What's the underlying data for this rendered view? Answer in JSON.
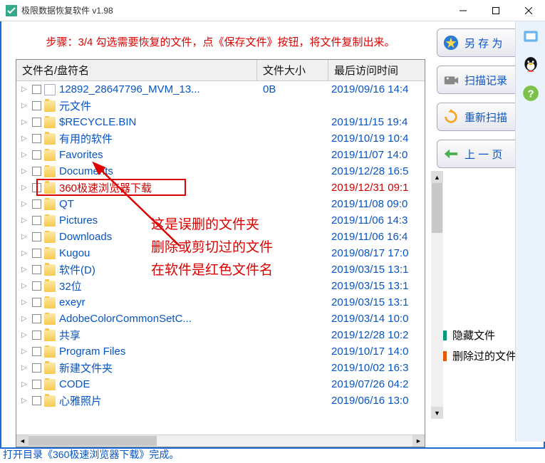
{
  "window": {
    "title": "极限数据恢复软件 v1.98"
  },
  "instruction": "步骤：3/4 勾选需要恢复的文件，点《保存文件》按钮，将文件复制出来。",
  "columns": {
    "name": "文件名/盘符名",
    "size": "文件大小",
    "date": "最后访问时间"
  },
  "files": [
    {
      "name": "12892_28647796_MVM_13...",
      "size": "0B",
      "date": "2019/09/16 14:4",
      "type": "file",
      "deleted": false
    },
    {
      "name": "元文件",
      "size": "",
      "date": "",
      "type": "folder",
      "deleted": false
    },
    {
      "name": "$RECYCLE.BIN",
      "size": "",
      "date": "2019/11/15 19:4",
      "type": "folder",
      "deleted": false
    },
    {
      "name": "有用的软件",
      "size": "",
      "date": "2019/10/19 10:4",
      "type": "folder",
      "deleted": false
    },
    {
      "name": "Favorites",
      "size": "",
      "date": "2019/11/07 14:0",
      "type": "folder",
      "deleted": false
    },
    {
      "name": "Documents",
      "size": "",
      "date": "2019/12/28 16:5",
      "type": "folder",
      "deleted": false
    },
    {
      "name": "360极速浏览器下载",
      "size": "",
      "date": "2019/12/31 09:1",
      "type": "folder",
      "deleted": true,
      "highlight": true
    },
    {
      "name": "QT",
      "size": "",
      "date": "2019/11/08 09:0",
      "type": "folder",
      "deleted": false
    },
    {
      "name": "Pictures",
      "size": "",
      "date": "2019/11/06 14:3",
      "type": "folder",
      "deleted": false
    },
    {
      "name": "Downloads",
      "size": "",
      "date": "2019/11/06 16:4",
      "type": "folder",
      "deleted": false
    },
    {
      "name": "Kugou",
      "size": "",
      "date": "2019/08/17 17:0",
      "type": "folder",
      "deleted": false
    },
    {
      "name": "软件(D)",
      "size": "",
      "date": "2019/03/15 13:1",
      "type": "folder",
      "deleted": false
    },
    {
      "name": "32位",
      "size": "",
      "date": "2019/03/15 13:1",
      "type": "folder",
      "deleted": false
    },
    {
      "name": "exeyr",
      "size": "",
      "date": "2019/03/15 13:1",
      "type": "folder",
      "deleted": false
    },
    {
      "name": "AdobeColorCommonSetC...",
      "size": "",
      "date": "2019/03/14 10:0",
      "type": "folder",
      "deleted": false
    },
    {
      "name": "共享",
      "size": "",
      "date": "2019/12/28 10:2",
      "type": "folder",
      "deleted": false
    },
    {
      "name": "Program Files",
      "size": "",
      "date": "2019/10/17 14:0",
      "type": "folder",
      "deleted": false
    },
    {
      "name": "新建文件夹",
      "size": "",
      "date": "2019/10/02 16:3",
      "type": "folder",
      "deleted": false
    },
    {
      "name": "CODE",
      "size": "",
      "date": "2019/07/26 04:2",
      "type": "folder",
      "deleted": false
    },
    {
      "name": "心雅照片",
      "size": "",
      "date": "2019/06/16 13:0",
      "type": "folder",
      "deleted": false
    }
  ],
  "overlay": {
    "line1": "这是误删的文件夹",
    "line2": "删除或剪切过的文件",
    "line3": "在软件是红色文件名"
  },
  "buttons": {
    "save": "另 存 为",
    "scanlog": "扫描记录",
    "rescan": "重新扫描",
    "prev": "上 一 页"
  },
  "legend": {
    "hidden": {
      "label": "隐藏文件",
      "color": "#009a7b"
    },
    "deleted": {
      "label": "删除过的文件",
      "color": "#e65a0d"
    }
  },
  "status": "打开目录《360极速浏览器下载》完成。"
}
